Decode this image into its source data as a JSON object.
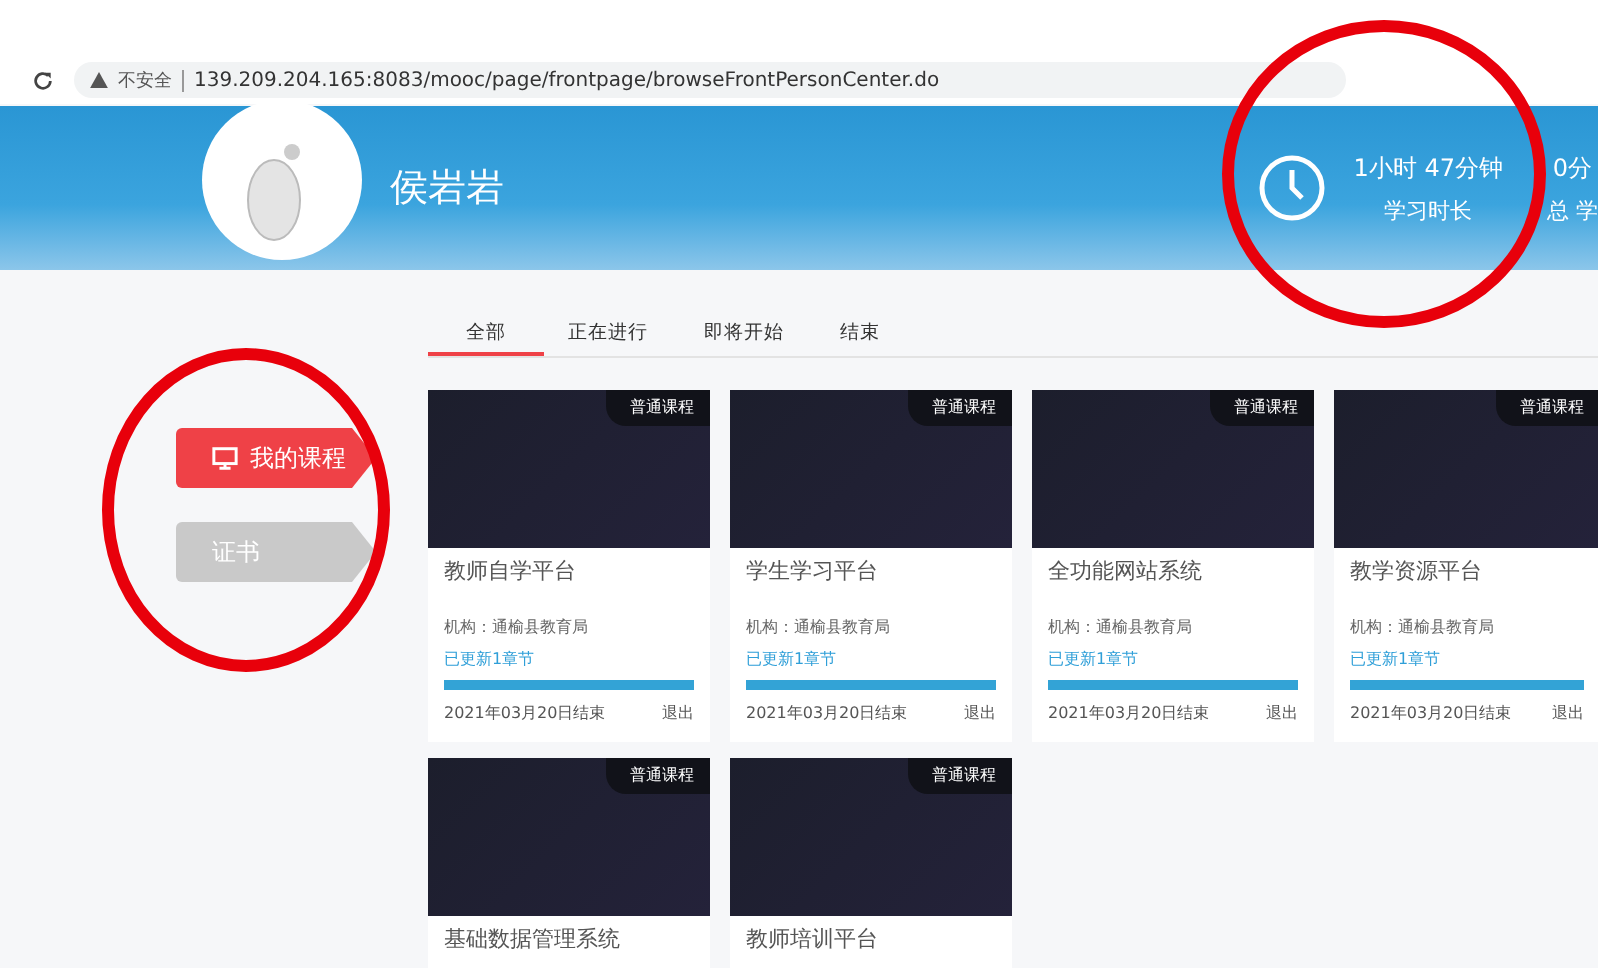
{
  "browser": {
    "security": "不安全",
    "url": "139.209.204.165:8083/mooc/page/frontpage/browseFrontPersonCenter.do"
  },
  "profile": {
    "name": "侯岩岩",
    "stats": [
      {
        "value": "1小时 47分钟",
        "label": "学习时长"
      },
      {
        "value": "0分",
        "label": "总 学"
      }
    ]
  },
  "sidebar": {
    "items": [
      {
        "label": "我的课程",
        "selected": true
      },
      {
        "label": "证书",
        "selected": false
      }
    ]
  },
  "tabs": [
    {
      "label": "全部",
      "selected": true
    },
    {
      "label": "正在进行",
      "selected": false
    },
    {
      "label": "即将开始",
      "selected": false
    },
    {
      "label": "结束",
      "selected": false
    }
  ],
  "courses": [
    {
      "tag": "普通课程",
      "title": "教师自学平台",
      "org": "机构：通榆县教育局",
      "update": "已更新1章节",
      "level": 1,
      "date": "2021年03月20日结束",
      "action": "退出"
    },
    {
      "tag": "普通课程",
      "title": "学生学习平台",
      "org": "机构：通榆县教育局",
      "update": "已更新1章节",
      "level": 1,
      "date": "2021年03月20日结束",
      "action": "退出"
    },
    {
      "tag": "普通课程",
      "title": "全功能网站系统",
      "org": "机构：通榆县教育局",
      "update": "已更新1章节",
      "level": 1,
      "date": "2021年03月20日结束",
      "action": "退出"
    },
    {
      "tag": "普通课程",
      "title": "教学资源平台",
      "org": "机构：通榆县教育局",
      "update": "已更新1章节",
      "level": 1,
      "date": "2021年03月20日结束",
      "action": "退出"
    },
    {
      "tag": "普通课程",
      "title": "基础数据管理系统"
    },
    {
      "tag": "普通课程",
      "title": "教师培训平台"
    }
  ]
}
